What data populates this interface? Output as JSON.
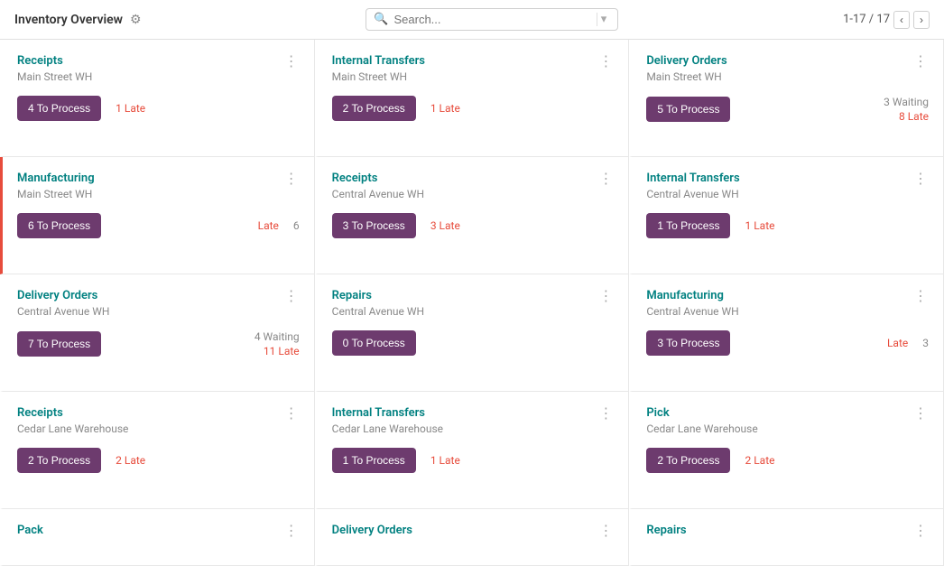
{
  "header": {
    "title": "Inventory Overview",
    "gear_label": "⚙",
    "search_placeholder": "Search...",
    "pagination": "1-17 / 17"
  },
  "cards": [
    {
      "title": "Receipts",
      "subtitle": "Main Street WH",
      "btn": "4 To Process",
      "late": "1 Late",
      "waiting": null,
      "number": null,
      "border": "none"
    },
    {
      "title": "Internal Transfers",
      "subtitle": "Main Street WH",
      "btn": "2 To Process",
      "late": "1 Late",
      "waiting": null,
      "number": null,
      "border": "none"
    },
    {
      "title": "Delivery Orders",
      "subtitle": "Main Street WH",
      "btn": "5 To Process",
      "late": "8 Late",
      "waiting": "3 Waiting",
      "number": null,
      "border": "none"
    },
    {
      "title": "Manufacturing",
      "subtitle": "Main Street WH",
      "btn": "6 To Process",
      "late": "Late",
      "waiting": null,
      "number": "6",
      "border": "red"
    },
    {
      "title": "Receipts",
      "subtitle": "Central Avenue WH",
      "btn": "3 To Process",
      "late": "3 Late",
      "waiting": null,
      "number": null,
      "border": "none"
    },
    {
      "title": "Internal Transfers",
      "subtitle": "Central Avenue WH",
      "btn": "1 To Process",
      "late": "1 Late",
      "waiting": null,
      "number": null,
      "border": "none"
    },
    {
      "title": "Delivery Orders",
      "subtitle": "Central Avenue WH",
      "btn": "7 To Process",
      "late": "11 Late",
      "waiting": "4 Waiting",
      "number": null,
      "border": "none"
    },
    {
      "title": "Repairs",
      "subtitle": "Central Avenue WH",
      "btn": "0 To Process",
      "late": null,
      "waiting": null,
      "number": null,
      "border": "none"
    },
    {
      "title": "Manufacturing",
      "subtitle": "Central Avenue WH",
      "btn": "3 To Process",
      "late": "Late",
      "waiting": null,
      "number": "3",
      "border": "none"
    },
    {
      "title": "Receipts",
      "subtitle": "Cedar Lane Warehouse",
      "btn": "2 To Process",
      "late": "2 Late",
      "waiting": null,
      "number": null,
      "border": "none"
    },
    {
      "title": "Internal Transfers",
      "subtitle": "Cedar Lane Warehouse",
      "btn": "1 To Process",
      "late": "1 Late",
      "waiting": null,
      "number": null,
      "border": "none"
    },
    {
      "title": "Pick",
      "subtitle": "Cedar Lane Warehouse",
      "btn": "2 To Process",
      "late": "2 Late",
      "waiting": null,
      "number": null,
      "border": "none"
    },
    {
      "title": "Pack",
      "subtitle": "",
      "btn": null,
      "late": null,
      "waiting": null,
      "number": null,
      "border": "none",
      "last": true
    },
    {
      "title": "Delivery Orders",
      "subtitle": "",
      "btn": null,
      "late": null,
      "waiting": null,
      "number": null,
      "border": "none",
      "last": true
    },
    {
      "title": "Repairs",
      "subtitle": "",
      "btn": null,
      "late": null,
      "waiting": null,
      "number": null,
      "border": "none",
      "last": true
    }
  ]
}
